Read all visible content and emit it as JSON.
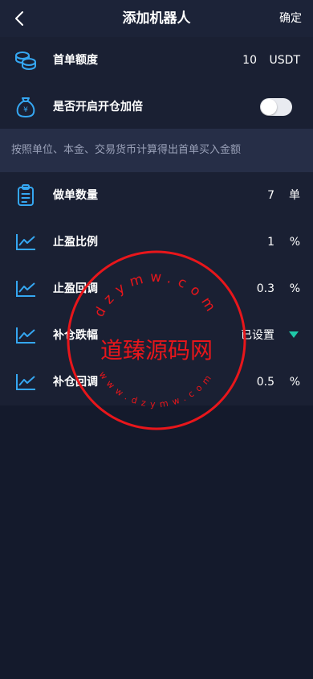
{
  "header": {
    "title": "添加机器人",
    "confirm_label": "确定",
    "back_icon": "chevron-left-icon"
  },
  "first_order_amount": {
    "label": "首单额度",
    "value": "10",
    "unit": "USDT",
    "icon": "coins-icon"
  },
  "double_open": {
    "label": "是否开启开仓加倍",
    "enabled": false,
    "icon": "money-bag-icon"
  },
  "hint": "按照单位、本金、交易货币计算得出首单买入金额",
  "order_count": {
    "label": "做单数量",
    "value": "7",
    "unit": "单",
    "icon": "clipboard-icon"
  },
  "take_profit_ratio": {
    "label": "止盈比例",
    "value": "1",
    "unit": "%",
    "icon": "line-chart-icon"
  },
  "take_profit_callback": {
    "label": "止盈回调",
    "value": "0.3",
    "unit": "%",
    "icon": "line-chart-icon"
  },
  "add_position_drop": {
    "label": "补仓跌幅",
    "value": "已设置",
    "icon": "line-chart-icon"
  },
  "add_position_callback": {
    "label": "补仓回调",
    "value": "0.5",
    "unit": "%",
    "icon": "line-chart-icon"
  },
  "watermark": {
    "text": "道臻源码网",
    "ring_top": "dzymw.com",
    "ring_bottom": "www.dzymw.com"
  },
  "colors": {
    "accent": "#1fc8a8",
    "icon_blue": "#35a7f2",
    "stamp_red": "#e8161b"
  }
}
